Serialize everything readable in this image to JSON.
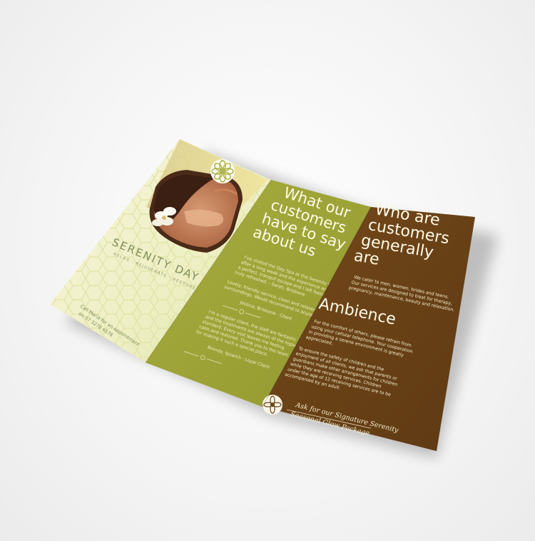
{
  "brochure": {
    "left_panel": {
      "spa_name": "SERENITY DAY SPA",
      "spa_tagline": "RELAX · REJUVENATE · RESTORE",
      "call_line_1": "Call Maria for an appointment",
      "call_line_2": "on 07 3278 6578"
    },
    "middle_panel": {
      "title_lines": [
        "What our",
        "customers",
        "have to say",
        "about us"
      ],
      "body_lines": [
        "I've visited the Day Spa at the Serenity Day Spa",
        "after a long week and the experience was wonderful,",
        "a perfect, tranquil escape and I left feeling",
        "truly refreshed. - Sarah, Brisbane",
        "Lovely, friendly service, clean and relaxed",
        "surroundings. Would recommend to anyone.",
        "Jessica, Brisbane - Client",
        "I'm a regular client, the staff are fantastic",
        "and the treatments are always of the highest",
        "standard. Every visit leaves me feeling",
        "calm and restored. Thank you to the team",
        "for making it such a special place.",
        "Brenda, Ipswich - Loyal Client"
      ]
    },
    "right_panel": {
      "title_lines": [
        "Who are",
        "customers",
        "generally",
        "are"
      ],
      "intro_lines": [
        "We cater to men, women, brides and teens.",
        "Our services are designed to treat for therapy,",
        "pregnancy, maintenance, beauty and relaxation."
      ],
      "ambience_heading": "Ambience",
      "ambience_lines": [
        "For the comfort of others, please refrain from",
        "using your cellular telephone. Your cooperation",
        "in providing a serene environment is greatly",
        "appreciated.",
        "To ensure the safety of children and the",
        "enjoyment of all clients, we ask that parents or",
        "guardians make other arrangements for children",
        "while they are receiving services. Children",
        "under the age of 12 receiving services are to be",
        "accompanied by an adult."
      ],
      "signature_lines": [
        "Ask for our Signature Serenity",
        "Seasonal Glow Package"
      ]
    },
    "colors": {
      "left_panel": "#eef0c6",
      "middle_panel": "#a0a53a",
      "right_panel": "#6b4217",
      "text_light": "#fffbe8"
    }
  }
}
